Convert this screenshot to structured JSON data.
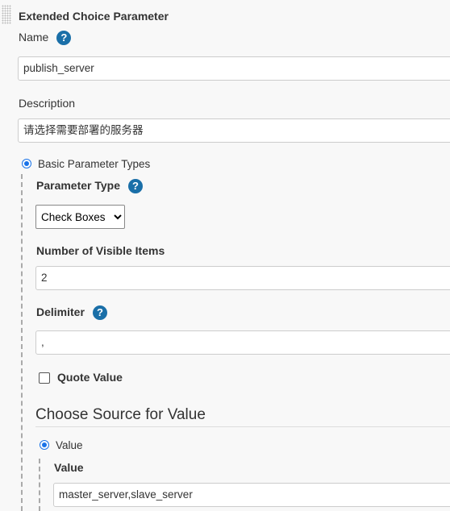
{
  "section_title": "Extended Choice Parameter",
  "name": {
    "label": "Name",
    "value": "publish_server"
  },
  "description": {
    "label": "Description",
    "value": "请选择需要部署的服务器"
  },
  "basic_types": {
    "label": "Basic Parameter Types",
    "selected": true
  },
  "parameter_type": {
    "label": "Parameter Type",
    "selected": "Check Boxes"
  },
  "visible_items": {
    "label": "Number of Visible Items",
    "value": "2"
  },
  "delimiter": {
    "label": "Delimiter",
    "value": ","
  },
  "quote_value": {
    "label": "Quote Value",
    "checked": false
  },
  "source_heading": "Choose Source for Value",
  "source_value": {
    "label": "Value",
    "selected": true
  },
  "value": {
    "label": "Value",
    "value": "master_server,slave_server"
  },
  "help_glyph": "?",
  "accent": "#1a73e8"
}
